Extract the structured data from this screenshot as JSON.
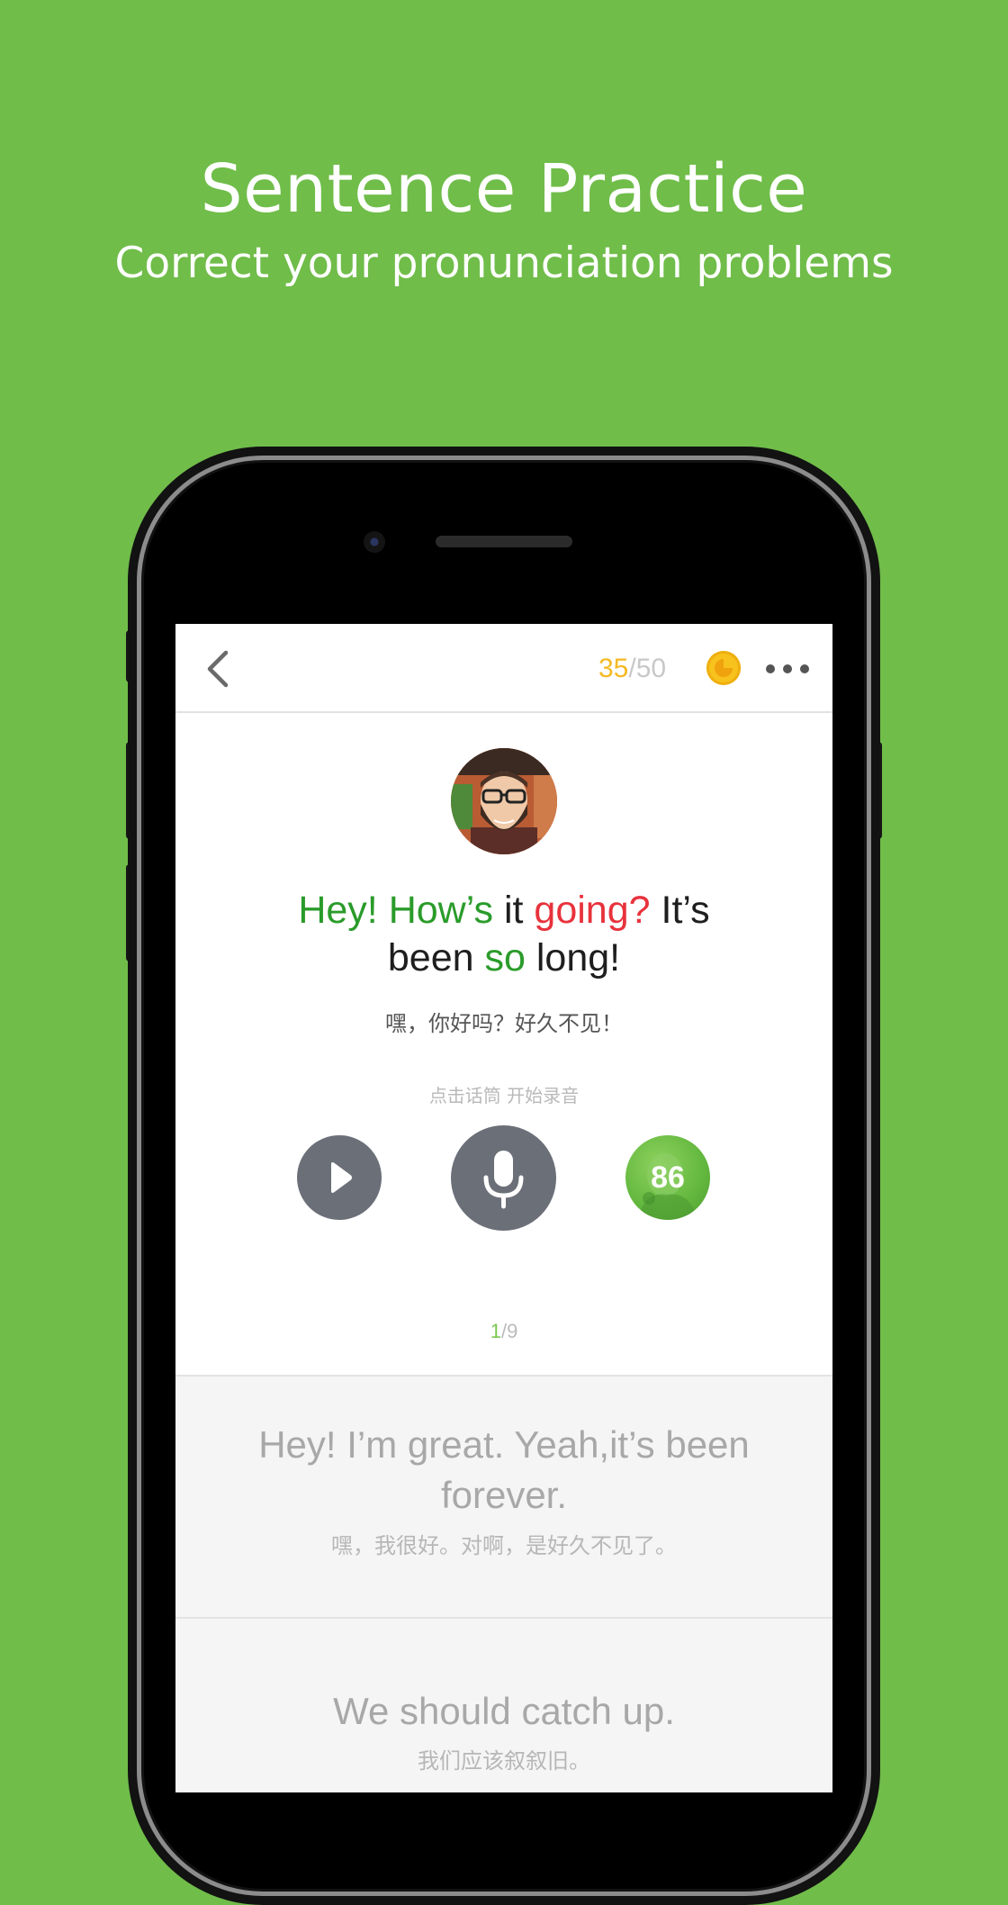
{
  "hero": {
    "title": "Sentence Practice",
    "subtitle": "Correct your pronunciation problems"
  },
  "navbar": {
    "score_current": "35",
    "score_separator": "/",
    "score_total": "50"
  },
  "sentence": {
    "words": [
      {
        "text": "Hey!",
        "color": "green"
      },
      {
        "text": "How’s",
        "color": "green"
      },
      {
        "text": "it",
        "color": "black"
      },
      {
        "text": "going?",
        "color": "red"
      },
      {
        "text": "It’s",
        "color": "black"
      },
      {
        "text": "been",
        "color": "black"
      },
      {
        "text": "so",
        "color": "green"
      },
      {
        "text": "long!",
        "color": "black"
      }
    ],
    "translation": "嘿，你好吗？好久不见！"
  },
  "controls": {
    "hint": "点击话筒 开始录音",
    "score": "86"
  },
  "pager": {
    "current": "1",
    "separator": "/",
    "total": "9"
  },
  "next_sentences": [
    {
      "en": "Hey! I’m great. Yeah,it’s been forever.",
      "zh": "嘿，我很好。对啊，是好久不见了。"
    },
    {
      "en": "We should catch up.",
      "zh": "我们应该叙叙旧。"
    }
  ],
  "colors": {
    "background": "#70BD4A",
    "correct": "#2A9B2A",
    "wrong": "#E8323C",
    "coin": "#F8C21C",
    "button": "#6B6F78"
  }
}
